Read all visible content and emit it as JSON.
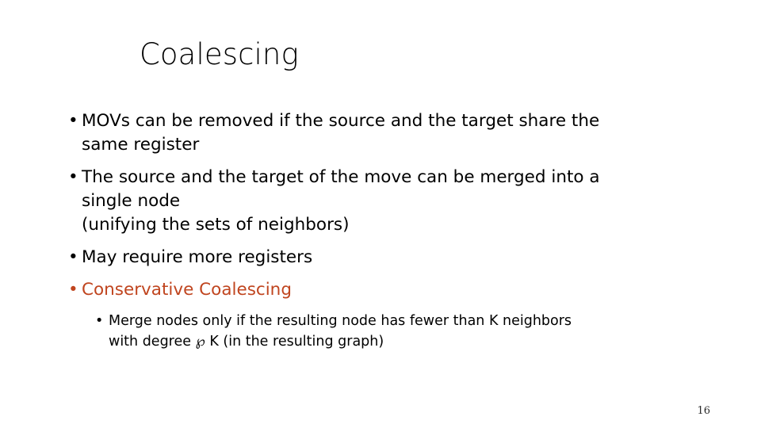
{
  "slide": {
    "title": "Coalescing",
    "page_number": "16",
    "accent_color": "#C0451F",
    "text_color": "#000000",
    "background_color": "#FFFFFF",
    "bullet_marker": "•",
    "bullets": [
      {
        "level": 1,
        "color": "#000000",
        "lines": [
          "MOVs can be removed if the source and the target share the",
          "same register"
        ],
        "text": "MOVs can be removed if the source and the target share the same register"
      },
      {
        "level": 1,
        "color": "#000000",
        "lines": [
          "The source and the target of the move can be merged into a",
          "single node",
          "(unifying the sets of neighbors)"
        ],
        "text": "The source and the target of the move can be merged into a single node (unifying the sets of neighbors)"
      },
      {
        "level": 1,
        "color": "#000000",
        "lines": [
          "May require more registers"
        ],
        "text": "May require more registers"
      },
      {
        "level": 1,
        "color": "#C0451F",
        "lines": [
          "Conservative Coalescing"
        ],
        "text": "Conservative Coalescing"
      },
      {
        "level": 2,
        "color": "#000000",
        "lines": [
          "Merge nodes only if the resulting node has fewer than K neighbors",
          "with degree ℘ K (in the resulting graph)"
        ],
        "text": "Merge nodes only if the resulting node has fewer than K neighbors with degree ℘ K (in the resulting graph)"
      }
    ]
  }
}
